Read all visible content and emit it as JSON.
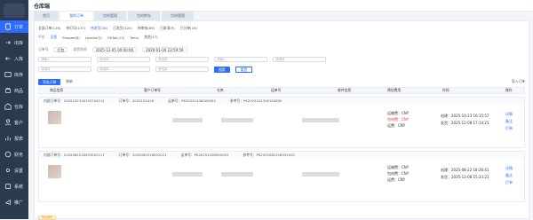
{
  "app": {
    "title": "仓库端",
    "tabs": [
      "首页",
      "我的订单",
      "包材管理",
      "包材库存",
      "包材管理"
    ]
  },
  "sidebar": {
    "items": [
      {
        "label": "订单"
      },
      {
        "label": "出库"
      },
      {
        "label": "入库"
      },
      {
        "label": "库存"
      },
      {
        "label": "商品"
      },
      {
        "label": "仓库"
      },
      {
        "label": "客户"
      },
      {
        "label": "报表"
      },
      {
        "label": "财务"
      },
      {
        "label": "设置"
      },
      {
        "label": "系统"
      },
      {
        "label": "推广"
      }
    ]
  },
  "status_tabs": [
    "全部订单(116)",
    "待打印(137)",
    "待发货(58)",
    "已发货(120)",
    "待审核(89)",
    "已取消(9)",
    "已分单(16)"
  ],
  "platform_filters": [
    "全部",
    "Shopee(8)",
    "Lazada(5)",
    "TikTok(13)",
    "Temu",
    "其他(17)"
  ],
  "filter_labels": [
    "订单号",
    "平台",
    "店铺",
    "物流",
    "发货时间"
  ],
  "filter_values": [
    "打包",
    "2025-12-05 00:00:00",
    "2026-01-04 23:59:59"
  ],
  "inputs": {
    "placeholders": [
      "请输入",
      "请选择",
      "请输入",
      "请选择",
      "请选择",
      "请选择",
      "请选择",
      "请选择"
    ],
    "search_button": "搜索",
    "reset_button": "重置"
  },
  "actions": {
    "export": "导出订单",
    "refresh": "刷新",
    "batch": "导入订单"
  },
  "table": {
    "headers": [
      "商品信息",
      "客户订单号",
      "仓库",
      "运单号",
      "收件信息",
      "预估费用",
      "时间",
      "操作"
    ],
    "orders": [
      {
        "order_no": "内部订单号：2025102316155700011",
        "customer": "订单号：2025102416",
        "tracking": "运单号：PK20251208000054",
        "ref": "参考号：PK2025102316154850",
        "fee1": "运输费：CNY",
        "fee2": "包材费：CNY",
        "fee3": "运费：CNY",
        "time1": "创建：2025-10-23 16:15:57",
        "time2": "发货：2025-12-08 17:14:21",
        "action1": "详情",
        "action2": "备注",
        "action3": "打单"
      },
      {
        "order_no": "内部订单号：2025082218553002117",
        "customer": "订单号：2025082218552021",
        "tracking": "运单号：PK20251208000053",
        "ref": "参考号：PK2025082218552002",
        "fee1": "运输费：CNY",
        "fee2": "包材费：CNY",
        "fee3": "运费：CNY",
        "time1": "创建：2025-08-22 18:26:41",
        "time2": "发货：2025-12-08 15:23:21",
        "action1": "详情",
        "action2": "备注",
        "action3": "打单"
      }
    ],
    "status_badge": "待处理中"
  }
}
